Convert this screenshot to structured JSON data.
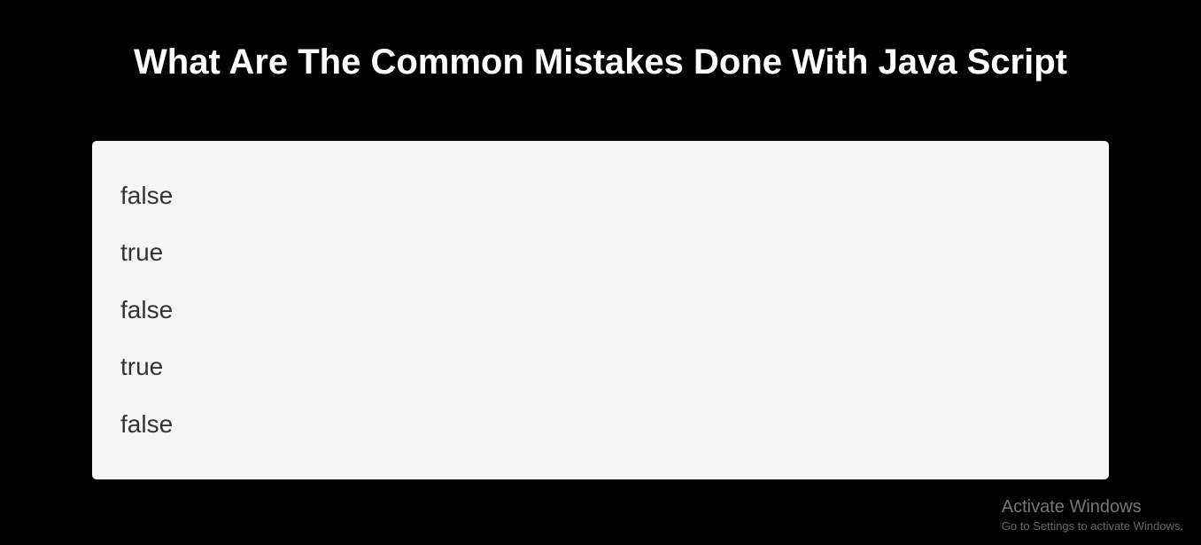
{
  "heading": "What Are The Common Mistakes Done With Java Script",
  "results": {
    "line1": "false",
    "line2": "true",
    "line3": "false",
    "line4": "true",
    "line5": "false"
  },
  "watermark": {
    "title": "Activate Windows",
    "subtitle": "Go to Settings to activate Windows."
  }
}
